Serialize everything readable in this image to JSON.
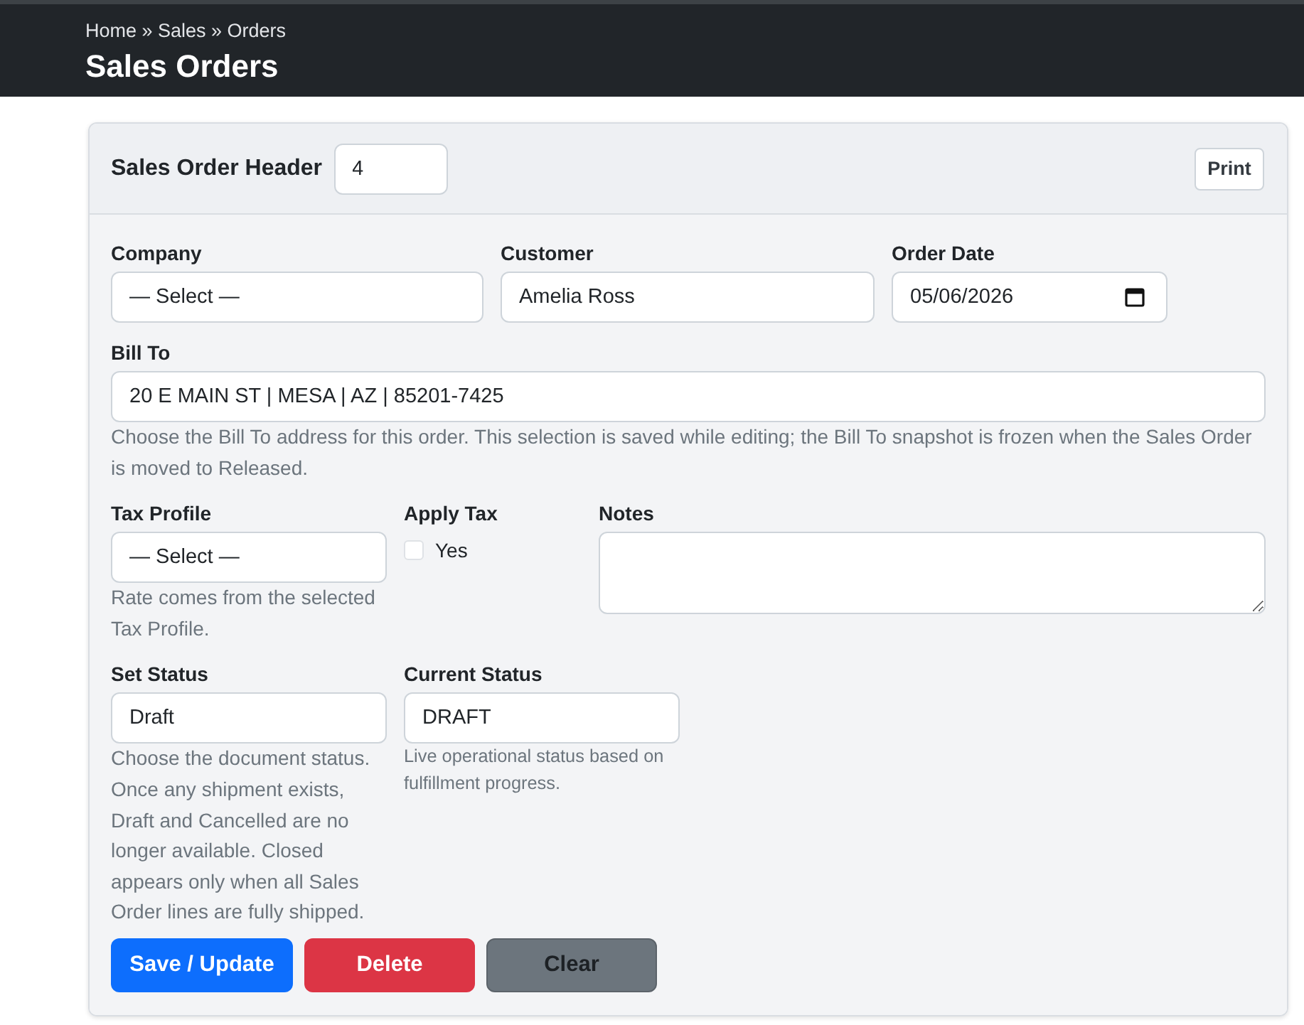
{
  "breadcrumb": "Home » Sales » Orders",
  "page_title": "Sales Orders",
  "card_header": {
    "title": "Sales Order Header",
    "order_number": "4",
    "print_button": "Print"
  },
  "form_rows": [
    {
      "fields": [
        {
          "kind": "input",
          "label": "Company",
          "value": "— Select —"
        },
        {
          "kind": "input",
          "label": "Customer",
          "value": "Amelia Ross"
        },
        {
          "kind": "date",
          "label": "Order Date",
          "value": "05/06/2026"
        }
      ]
    },
    {
      "fields": [
        {
          "kind": "input",
          "label": "Bill To",
          "value": "20 E MAIN ST | MESA | AZ | 85201-7425",
          "help": "Choose the Bill To address for this order. This selection is saved while editing; the Bill To snapshot is frozen when the Sales Order is moved to Released."
        }
      ]
    },
    {
      "fields": [
        {
          "kind": "input",
          "label": "Tax Profile",
          "value": "— Select —",
          "help": "Rate comes from the selected Tax Profile."
        },
        {
          "kind": "checkbox",
          "label": "Apply Tax",
          "option": "Yes",
          "checked": false
        },
        {
          "kind": "textarea",
          "label": "Notes"
        }
      ]
    },
    {
      "fields": [
        {
          "kind": "input",
          "label": "Set Status",
          "value": "Draft",
          "help": "Choose the document status. Once any shipment exists, Draft and Cancelled are no longer available. Closed appears only when all Sales Order lines are fully shipped."
        },
        {
          "kind": "status",
          "label": "Current Status",
          "value": "DRAFT",
          "help": "Live operational status based on fulfillment progress."
        }
      ]
    }
  ],
  "buttons": [
    {
      "kind": "primary",
      "label": "Save / Update"
    },
    {
      "kind": "danger",
      "label": "Delete"
    },
    {
      "kind": "secondary",
      "label": "Clear"
    }
  ]
}
